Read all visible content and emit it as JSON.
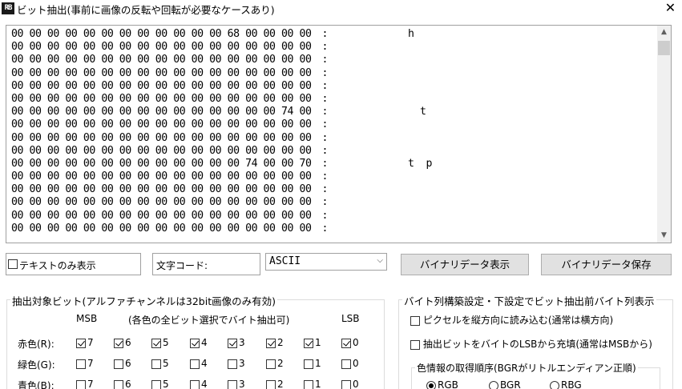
{
  "window": {
    "icon_text": "RB",
    "title": "ビット抽出(事前に画像の反転や回転が必要なケースあり)",
    "close_label": "✕"
  },
  "dump": {
    "lines": [
      {
        "hex": "00 00 00 00 00 00 00 00 00 00 00 00 68 00 00 00 00",
        "sep": " :",
        "ascii": "h"
      },
      {
        "hex": "00 00 00 00 00 00 00 00 00 00 00 00 00 00 00 00 00",
        "sep": " :",
        "ascii": ""
      },
      {
        "hex": "00 00 00 00 00 00 00 00 00 00 00 00 00 00 00 00 00",
        "sep": " :",
        "ascii": ""
      },
      {
        "hex": "00 00 00 00 00 00 00 00 00 00 00 00 00 00 00 00 00",
        "sep": " :",
        "ascii": ""
      },
      {
        "hex": "00 00 00 00 00 00 00 00 00 00 00 00 00 00 00 00 00",
        "sep": " :",
        "ascii": ""
      },
      {
        "hex": "00 00 00 00 00 00 00 00 00 00 00 00 00 00 00 00 00",
        "sep": " :",
        "ascii": ""
      },
      {
        "hex": "00 00 00 00 00 00 00 00 00 00 00 00 00 00 00 74 00",
        "sep": " :",
        "ascii": "  t"
      },
      {
        "hex": "00 00 00 00 00 00 00 00 00 00 00 00 00 00 00 00 00",
        "sep": " :",
        "ascii": ""
      },
      {
        "hex": "00 00 00 00 00 00 00 00 00 00 00 00 00 00 00 00 00",
        "sep": " :",
        "ascii": ""
      },
      {
        "hex": "00 00 00 00 00 00 00 00 00 00 00 00 00 00 00 00 00",
        "sep": " :",
        "ascii": ""
      },
      {
        "hex": "00 00 00 00 00 00 00 00 00 00 00 00 00 74 00 00 70",
        "sep": " :",
        "ascii": "t  p"
      },
      {
        "hex": "00 00 00 00 00 00 00 00 00 00 00 00 00 00 00 00 00",
        "sep": " :",
        "ascii": ""
      },
      {
        "hex": "00 00 00 00 00 00 00 00 00 00 00 00 00 00 00 00 00",
        "sep": " :",
        "ascii": ""
      },
      {
        "hex": "00 00 00 00 00 00 00 00 00 00 00 00 00 00 00 00 00",
        "sep": " :",
        "ascii": ""
      },
      {
        "hex": "00 00 00 00 00 00 00 00 00 00 00 00 00 00 00 00 00",
        "sep": " :",
        "ascii": ""
      },
      {
        "hex": "00 00 00 00 00 00 00 00 00 00 00 00 00 00 00 00 00",
        "sep": " :",
        "ascii": ""
      }
    ],
    "scroll_up": "▲",
    "scroll_down": "▼"
  },
  "controls": {
    "text_only_label": "テキストのみ表示",
    "text_only_checked": false,
    "encoding_label": "文字コード:",
    "encoding_value": "ASCII",
    "show_binary_button": "バイナリデータ表示",
    "save_binary_button": "バイナリデータ保存"
  },
  "bit_group": {
    "title": "抽出対象ビット(アルファチャンネルは32bit画像のみ有効)",
    "msb_label": "MSB",
    "note": "(各色の全ビット選択でバイト抽出可)",
    "lsb_label": "LSB",
    "rows": [
      {
        "label": "赤色(R):",
        "bits": [
          {
            "n": "7",
            "checked": true
          },
          {
            "n": "6",
            "checked": true
          },
          {
            "n": "5",
            "checked": true
          },
          {
            "n": "4",
            "checked": true
          },
          {
            "n": "3",
            "checked": true
          },
          {
            "n": "2",
            "checked": true
          },
          {
            "n": "1",
            "checked": true
          },
          {
            "n": "0",
            "checked": true
          }
        ]
      },
      {
        "label": "緑色(G):",
        "bits": [
          {
            "n": "7",
            "checked": false
          },
          {
            "n": "6",
            "checked": false
          },
          {
            "n": "5",
            "checked": false
          },
          {
            "n": "4",
            "checked": false
          },
          {
            "n": "3",
            "checked": false
          },
          {
            "n": "2",
            "checked": false
          },
          {
            "n": "1",
            "checked": false
          },
          {
            "n": "0",
            "checked": false
          }
        ]
      },
      {
        "label": "青色(B):",
        "bits": [
          {
            "n": "7",
            "checked": false
          },
          {
            "n": "6",
            "checked": false
          },
          {
            "n": "5",
            "checked": false
          },
          {
            "n": "4",
            "checked": false
          },
          {
            "n": "3",
            "checked": false
          },
          {
            "n": "2",
            "checked": false
          },
          {
            "n": "1",
            "checked": false
          },
          {
            "n": "0",
            "checked": false
          }
        ]
      }
    ]
  },
  "byte_group": {
    "title": "バイト列構築設定・下設定でビット抽出前バイト列表示",
    "vertical_read_label": "ピクセルを縦方向に読み込む(通常は横方向)",
    "vertical_read_checked": false,
    "lsb_fill_label": "抽出ビットをバイトのLSBから充填(通常はMSBから)",
    "lsb_fill_checked": false,
    "order_group": {
      "title": "色情報の取得順序(BGRがリトルエンディアン正順)",
      "options": [
        {
          "label": "RGB",
          "selected": true
        },
        {
          "label": "BGR",
          "selected": false
        },
        {
          "label": "RBG",
          "selected": false
        }
      ]
    }
  }
}
